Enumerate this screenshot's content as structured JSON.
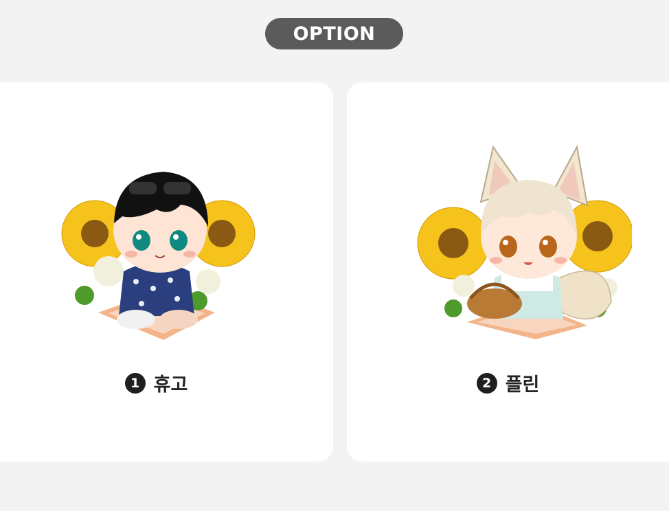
{
  "header": {
    "title": "OPTION"
  },
  "options": [
    {
      "number": "1",
      "name": "휴고",
      "image": "chibi-hugo-sunflower-icon"
    },
    {
      "number": "2",
      "name": "플린",
      "image": "chibi-flynn-fox-sunflower-icon"
    }
  ]
}
